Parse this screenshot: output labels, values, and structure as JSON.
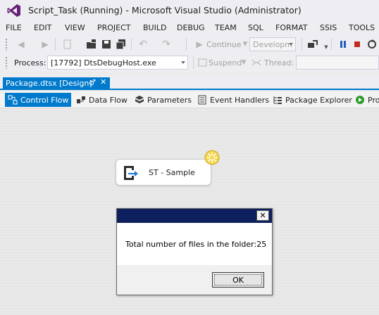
{
  "window": {
    "title": "Script_Task (Running) - Microsoft Visual Studio (Administrator)"
  },
  "menu": [
    "FILE",
    "EDIT",
    "VIEW",
    "PROJECT",
    "BUILD",
    "DEBUG",
    "TEAM",
    "SQL",
    "FORMAT",
    "SSIS",
    "TOOLS"
  ],
  "toolbar1": {
    "continue_label": "Continue",
    "config_value": "Developm"
  },
  "toolbar2": {
    "process_label": "Process:",
    "process_value": "[17792] DtsDebugHost.exe",
    "suspend_label": "Suspend",
    "thread_label": "Thread:"
  },
  "doc_tab": {
    "label": "Package.dtsx [Design]",
    "pin_glyph": "♂",
    "close_glyph": "✕"
  },
  "designer_tabs": [
    "Control Flow",
    "Data Flow",
    "Parameters",
    "Event Handlers",
    "Package Explorer",
    "Pro"
  ],
  "task": {
    "label": "ST - Sample"
  },
  "message_box": {
    "text": "Total number of files in the folder:25",
    "ok_label": "OK",
    "close_glyph": "✕"
  },
  "colors": {
    "accent": "#007acc",
    "vs_purple": "#68217a",
    "dialog_title": "#0e1f5d",
    "running_indicator": "#f5d64a",
    "canvas": "#e9e9e9"
  }
}
